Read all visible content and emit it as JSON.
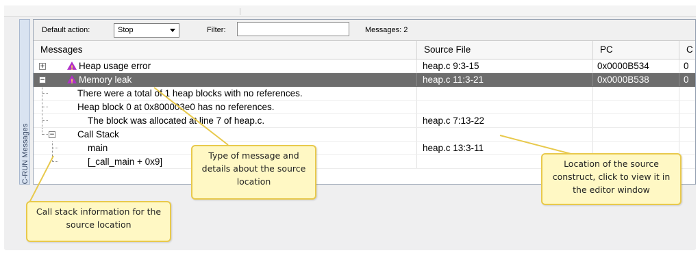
{
  "toolbar": {
    "default_action_label": "Default action:",
    "default_action_value": "Stop",
    "filter_label": "Filter:",
    "filter_value": "",
    "messages_count": "Messages: 2"
  },
  "side_tab": {
    "label": "C-RUN Messages",
    "close_glyph": "×"
  },
  "columns": [
    "Messages",
    "Source File",
    "PC",
    "C"
  ],
  "rows": [
    {
      "message": "Heap usage error",
      "source": "heap.c 9:3-15",
      "pc": "0x0000B534",
      "c": "0",
      "expander": "+",
      "icon": "warning-icon"
    },
    {
      "message": "Memory leak",
      "source": "heap.c 11:3-21",
      "pc": "0x0000B538",
      "c": "0",
      "expander": "−",
      "icon": "warning-icon"
    },
    {
      "message": "There were a total of 1 heap blocks with no references.",
      "source": "",
      "pc": "",
      "c": ""
    },
    {
      "message": "Heap block 0 at 0x800003e0 has no references.",
      "source": "",
      "pc": "",
      "c": ""
    },
    {
      "message": "The block was allocated at line 7 of heap.c.",
      "source": "heap.c 7:13-22",
      "pc": "",
      "c": ""
    },
    {
      "message": "Call Stack",
      "source": "",
      "pc": "",
      "c": "",
      "expander": "−"
    },
    {
      "message": "main",
      "source": "heap.c 13:3-11",
      "pc": "",
      "c": ""
    },
    {
      "message": "[_call_main + 0x9]",
      "source": "",
      "pc": "",
      "c": ""
    }
  ],
  "callouts": {
    "message_type": "Type of message and details about the source location",
    "source_location": "Location of the source construct, click to view it in the editor window",
    "call_stack": "Call stack information for the source location"
  },
  "colors": {
    "selected_row": "#6d6d6d",
    "warning_icon": "#b030c8",
    "callout_fill": "#fff8c4",
    "callout_border": "#e8c94c"
  }
}
